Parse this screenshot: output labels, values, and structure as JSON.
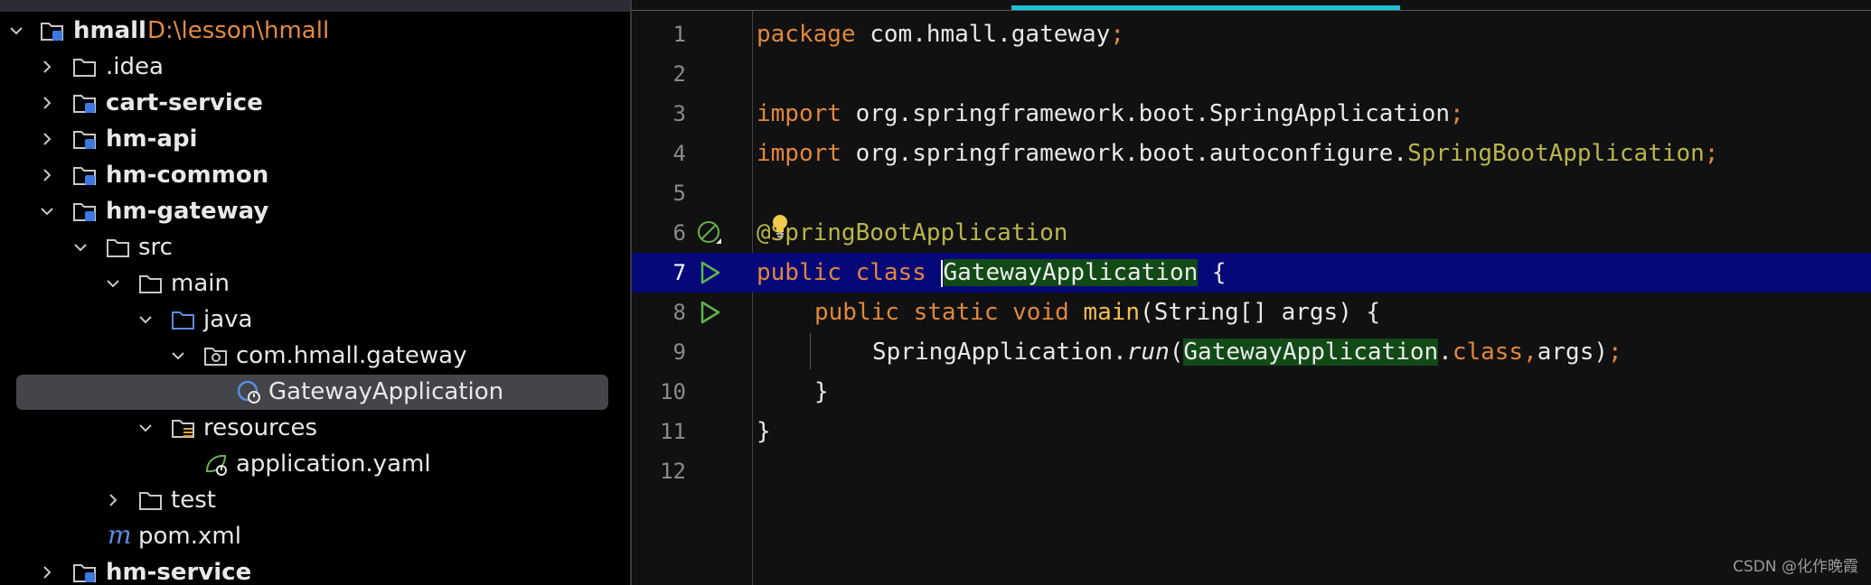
{
  "project_tree": {
    "root": {
      "label": "hmall",
      "path": "D:\\lesson\\hmall"
    },
    "items": [
      {
        "label": ".idea"
      },
      {
        "label": "cart-service"
      },
      {
        "label": "hm-api"
      },
      {
        "label": "hm-common"
      },
      {
        "label": "hm-gateway"
      },
      {
        "label": "src"
      },
      {
        "label": "main"
      },
      {
        "label": "java"
      },
      {
        "label": "com.hmall.gateway"
      },
      {
        "label": "GatewayApplication"
      },
      {
        "label": "resources"
      },
      {
        "label": "application.yaml"
      },
      {
        "label": "test"
      },
      {
        "label": "pom.xml"
      },
      {
        "label": "hm-service"
      }
    ]
  },
  "editor": {
    "line_numbers": [
      "1",
      "2",
      "3",
      "4",
      "5",
      "6",
      "7",
      "8",
      "9",
      "10",
      "11",
      "12"
    ],
    "current_line": 7,
    "code": {
      "l1": {
        "kw": "package",
        "rest": " com.hmall.gateway",
        "semi": ";"
      },
      "l3": {
        "kw": "import",
        "pkg": " org.springframework.boot.SpringApplication",
        "semi": ";"
      },
      "l4": {
        "kw": "import",
        "pkg": " org.springframework.boot.autoconfigure.",
        "cls": "SpringBootApplication",
        "semi": ";"
      },
      "l6": {
        "ann": "@SpringBootApplication"
      },
      "l7": {
        "kw": "public class ",
        "name": "GatewayApplication",
        "rest": " {"
      },
      "l8": {
        "kw": "public static void ",
        "fn": "main",
        "rest": "(String[] args) {"
      },
      "l9": {
        "obj": "SpringApplication.",
        "method": "run",
        "open": "(",
        "arg": "GatewayApplication",
        "dot": ".",
        "kwclass": "class",
        "comma": ",",
        "args": "args)",
        "semi": ";"
      },
      "l10": {
        "text": "}"
      },
      "l11": {
        "text": "}"
      }
    }
  },
  "watermark": "CSDN @化作晚霞",
  "icons": {
    "folder": "folder-icon",
    "module": "module-folder-icon",
    "package": "package-icon",
    "spring_class": "spring-boot-class-icon",
    "yaml": "spring-yaml-icon",
    "maven": "maven-icon",
    "run": "run-gutter-icon",
    "bean": "spring-bean-gutter-icon",
    "bulb": "lightbulb-icon"
  },
  "colors": {
    "keyword": "#e0873c",
    "annotation": "#b9b54c",
    "function": "#f3c04e",
    "current_line": "#06087a",
    "identifier_highlight": "#124a16",
    "active_tab": "#1cc3d6",
    "path": "#e08a45"
  }
}
